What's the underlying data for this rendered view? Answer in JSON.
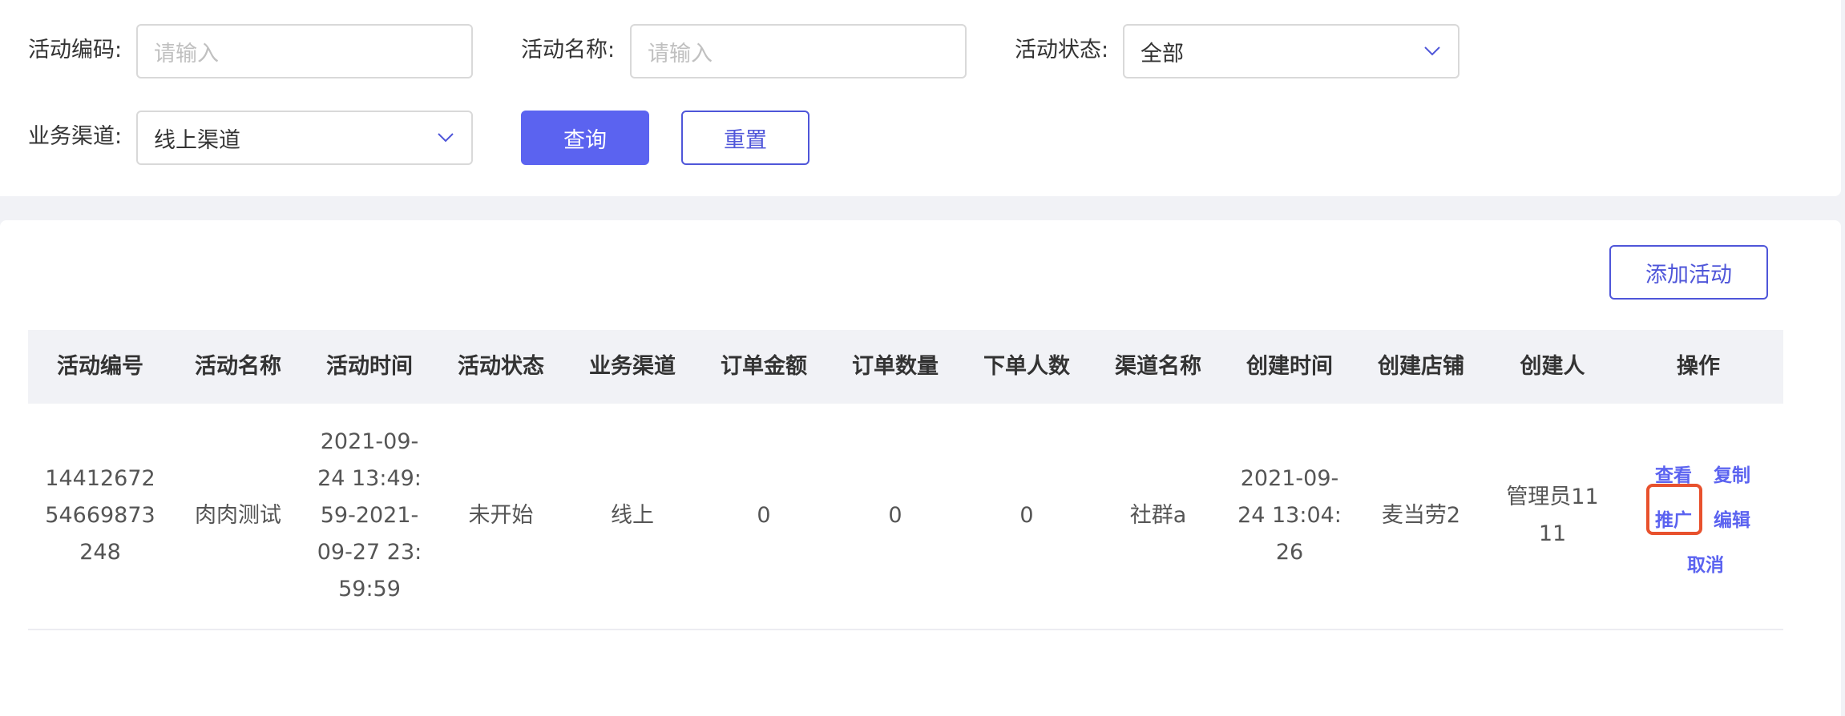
{
  "filters": {
    "activity_code": {
      "label": "活动编码:",
      "placeholder": "请输入"
    },
    "activity_name": {
      "label": "活动名称:",
      "placeholder": "请输入"
    },
    "activity_status": {
      "label": "活动状态:",
      "value": "全部"
    },
    "business_channel": {
      "label": "业务渠道:",
      "value": "线上渠道"
    },
    "query_label": "查询",
    "reset_label": "重置"
  },
  "toolbar": {
    "add_label": "添加活动"
  },
  "table": {
    "columns": [
      "活动编号",
      "活动名称",
      "活动时间",
      "活动状态",
      "业务渠道",
      "订单金额",
      "订单数量",
      "下单人数",
      "渠道名称",
      "创建时间",
      "创建店铺",
      "创建人",
      "操作"
    ],
    "rows": [
      {
        "id_lines": [
          "14412672",
          "54669873",
          "248"
        ],
        "name": "肉肉测试",
        "time_lines": [
          "2021-09-",
          "24 13:49:",
          "59-2021-",
          "09-27 23:",
          "59:59"
        ],
        "status": "未开始",
        "channel": "线上",
        "order_amount": "0",
        "order_count": "0",
        "buyer_count": "0",
        "channel_name": "社群a",
        "created_lines": [
          "2021-09-",
          "24 13:04:",
          "26"
        ],
        "store": "麦当劳2",
        "creator_lines": [
          "管理员11",
          "11"
        ],
        "actions": {
          "view": "查看",
          "copy": "复制",
          "promote": "推广",
          "edit": "编辑",
          "cancel": "取消"
        }
      }
    ]
  },
  "colors": {
    "accent": "#5b63f0",
    "highlight": "#e8512d"
  }
}
